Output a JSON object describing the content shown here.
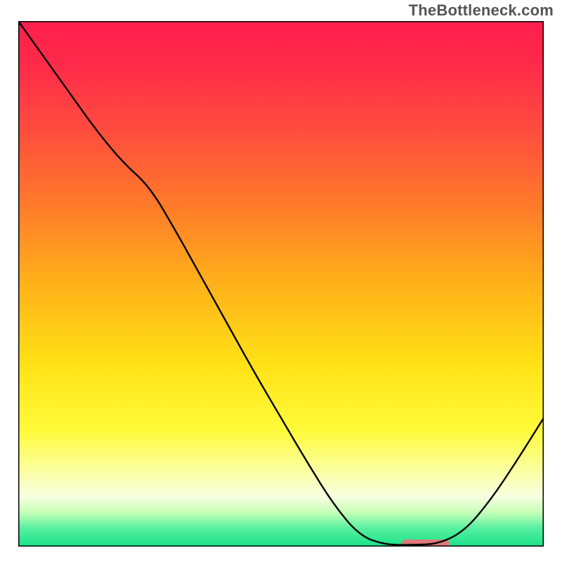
{
  "watermark": "TheBottleneck.com",
  "chart_data": {
    "type": "line",
    "title": "",
    "xlabel": "",
    "ylabel": "",
    "xlim": [
      0,
      100
    ],
    "ylim": [
      0,
      100
    ],
    "grid": false,
    "legend": null,
    "annotations": [],
    "series": [
      {
        "name": "bottleneck curve",
        "x": [
          0,
          5,
          10,
          15,
          20,
          25,
          30,
          35,
          40,
          45,
          50,
          55,
          60,
          65,
          70,
          75,
          80,
          85,
          90,
          95,
          100
        ],
        "y": [
          100,
          93,
          86,
          79,
          73,
          68.5,
          60,
          51,
          42,
          33,
          24.5,
          16,
          8,
          2,
          0.3,
          0.3,
          0.5,
          3,
          9,
          16.5,
          24.5
        ]
      }
    ],
    "marker": {
      "name": "optimal-range",
      "x_start": 73,
      "x_end": 82,
      "y": 0.6,
      "color": "#e07a7a"
    },
    "gradient_stops": [
      {
        "offset": 0.0,
        "color": "#ff1f4c"
      },
      {
        "offset": 0.08,
        "color": "#ff2a4a"
      },
      {
        "offset": 0.2,
        "color": "#ff4a3f"
      },
      {
        "offset": 0.35,
        "color": "#ff7a2a"
      },
      {
        "offset": 0.5,
        "color": "#ffb119"
      },
      {
        "offset": 0.65,
        "color": "#ffe116"
      },
      {
        "offset": 0.78,
        "color": "#fffb3a"
      },
      {
        "offset": 0.86,
        "color": "#fbffa8"
      },
      {
        "offset": 0.905,
        "color": "#f7ffe0"
      },
      {
        "offset": 0.935,
        "color": "#c7ffb8"
      },
      {
        "offset": 0.965,
        "color": "#58f0a0"
      },
      {
        "offset": 1.0,
        "color": "#19e28a"
      }
    ]
  }
}
